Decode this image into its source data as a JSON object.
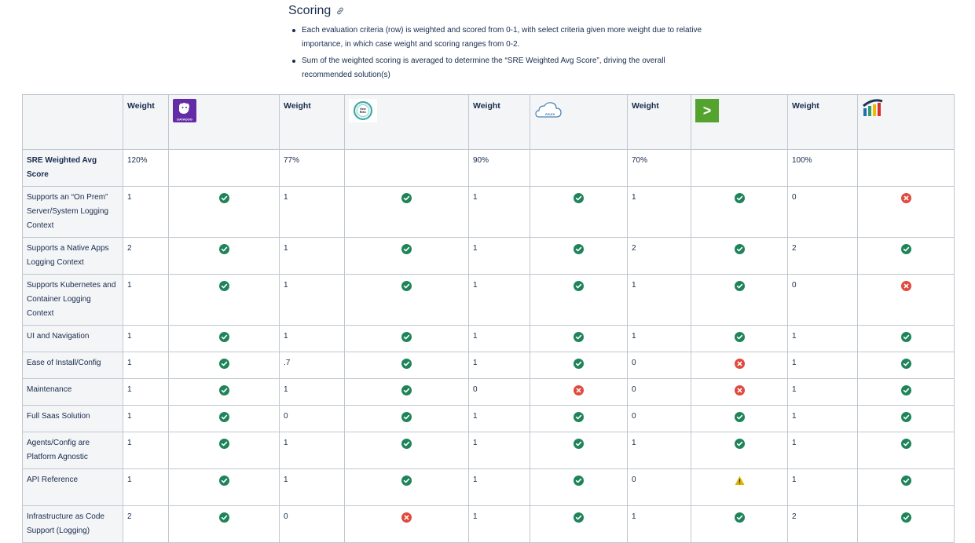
{
  "page": {
    "heading": "Scoring",
    "bullets": [
      "Each evaluation criteria (row) is weighted and scored from 0-1, with select criteria given more weight due to relative importance, in which case weight and scoring ranges from 0-2.",
      "Sum of the weighted scoring is averaged to determine the “SRE Weighted Avg Score”, driving the overall recommended solution(s)"
    ]
  },
  "table": {
    "weight_header": "Weight",
    "vendors": [
      {
        "logo": "datadog-logo",
        "logo_text": "DATADOG",
        "score": "120%"
      },
      {
        "logo": "new-relic-logo",
        "logo_text": "New Relic",
        "score": "77%"
      },
      {
        "logo": "azure-logo",
        "logo_text": "Azure",
        "score": "90%"
      },
      {
        "logo": "terminal-logo",
        "logo_text": ">",
        "score": "70%"
      },
      {
        "logo": "bar-chart-logo",
        "logo_text": "",
        "score": "100%"
      }
    ],
    "score_row_label": "SRE Weighted Avg Score",
    "rows": [
      {
        "label": "Supports an “On Prem” Server/System Logging Context",
        "cells": [
          {
            "w": "1",
            "s": "check"
          },
          {
            "w": "1",
            "s": "check"
          },
          {
            "w": "1",
            "s": "check"
          },
          {
            "w": "1",
            "s": "check"
          },
          {
            "w": "0",
            "s": "cross"
          }
        ]
      },
      {
        "label": "Supports a Native Apps Logging Context",
        "cells": [
          {
            "w": "2",
            "s": "check"
          },
          {
            "w": "1",
            "s": "check"
          },
          {
            "w": "1",
            "s": "check"
          },
          {
            "w": "2",
            "s": "check"
          },
          {
            "w": "2",
            "s": "check"
          }
        ]
      },
      {
        "label": "Supports Kubernetes and Container Logging Context",
        "cells": [
          {
            "w": "1",
            "s": "check"
          },
          {
            "w": "1",
            "s": "check"
          },
          {
            "w": "1",
            "s": "check"
          },
          {
            "w": "1",
            "s": "check"
          },
          {
            "w": "0",
            "s": "cross"
          }
        ]
      },
      {
        "label": "UI and Navigation",
        "cells": [
          {
            "w": "1",
            "s": "check"
          },
          {
            "w": "1",
            "s": "check"
          },
          {
            "w": "1",
            "s": "check"
          },
          {
            "w": "1",
            "s": "check"
          },
          {
            "w": "1",
            "s": "check"
          }
        ]
      },
      {
        "label": "Ease of Install/Config",
        "cells": [
          {
            "w": "1",
            "s": "check"
          },
          {
            "w": ".7",
            "s": "check"
          },
          {
            "w": "1",
            "s": "check"
          },
          {
            "w": "0",
            "s": "cross"
          },
          {
            "w": "1",
            "s": "check"
          }
        ]
      },
      {
        "label": "Maintenance",
        "cells": [
          {
            "w": "1",
            "s": "check"
          },
          {
            "w": "1",
            "s": "check"
          },
          {
            "w": "0",
            "s": "cross"
          },
          {
            "w": "0",
            "s": "cross"
          },
          {
            "w": "1",
            "s": "check"
          }
        ]
      },
      {
        "label": "Full Saas Solution",
        "cells": [
          {
            "w": "1",
            "s": "check"
          },
          {
            "w": "0",
            "s": "check"
          },
          {
            "w": "1",
            "s": "check"
          },
          {
            "w": "0",
            "s": "check"
          },
          {
            "w": "1",
            "s": "check"
          }
        ]
      },
      {
        "label": "Agents/Config are Platform Agnostic",
        "cells": [
          {
            "w": "1",
            "s": "check"
          },
          {
            "w": "1",
            "s": "check"
          },
          {
            "w": "1",
            "s": "check"
          },
          {
            "w": "1",
            "s": "check"
          },
          {
            "w": "1",
            "s": "check"
          }
        ]
      },
      {
        "label": "API Reference",
        "cells": [
          {
            "w": "1",
            "s": "check"
          },
          {
            "w": "1",
            "s": "check"
          },
          {
            "w": "1",
            "s": "check"
          },
          {
            "w": "0",
            "s": "warning"
          },
          {
            "w": "1",
            "s": "check"
          }
        ]
      },
      {
        "label": "Infrastructure as Code Support (Logging)",
        "cells": [
          {
            "w": "2",
            "s": "check"
          },
          {
            "w": "0",
            "s": "cross"
          },
          {
            "w": "1",
            "s": "check"
          },
          {
            "w": "1",
            "s": "check"
          },
          {
            "w": "2",
            "s": "check"
          }
        ]
      }
    ]
  },
  "colors": {
    "check": "#1f845a",
    "cross": "#e2483d",
    "warning": "#e2b203",
    "header_bg": "#f4f5f7",
    "border": "#c1c7d0"
  }
}
